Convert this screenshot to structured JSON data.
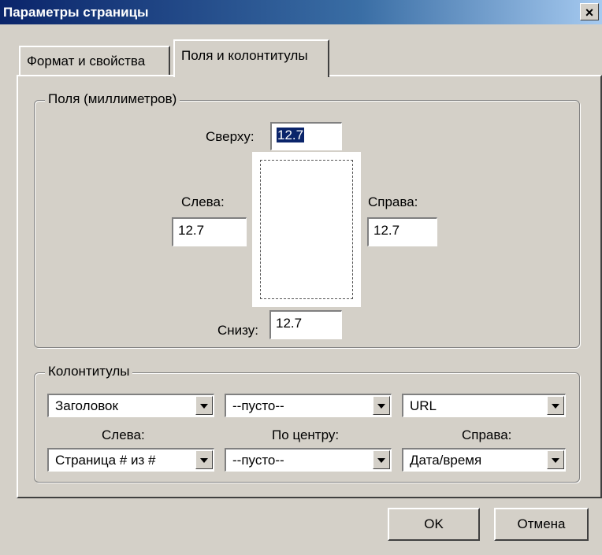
{
  "window": {
    "title": "Параметры страницы",
    "close_glyph": "×"
  },
  "tabs": [
    {
      "label": "Формат и свойства"
    },
    {
      "label": "Поля и колонтитулы"
    }
  ],
  "margins": {
    "group_label": "Поля (миллиметров)",
    "top_label": "Сверху:",
    "top_value": "12.7",
    "left_label": "Слева:",
    "left_value": "12.7",
    "right_label": "Справа:",
    "right_value": "12.7",
    "bottom_label": "Снизу:",
    "bottom_value": "12.7"
  },
  "headers_footers": {
    "group_label": "Колонтитулы",
    "header_left": "Заголовок",
    "header_center": "--пусто--",
    "header_right": "URL",
    "label_left": "Слева:",
    "label_center": "По центру:",
    "label_right": "Справа:",
    "footer_left": "Страница # из #",
    "footer_center": "--пусто--",
    "footer_right": "Дата/время"
  },
  "buttons": {
    "ok": "OK",
    "cancel": "Отмена"
  }
}
